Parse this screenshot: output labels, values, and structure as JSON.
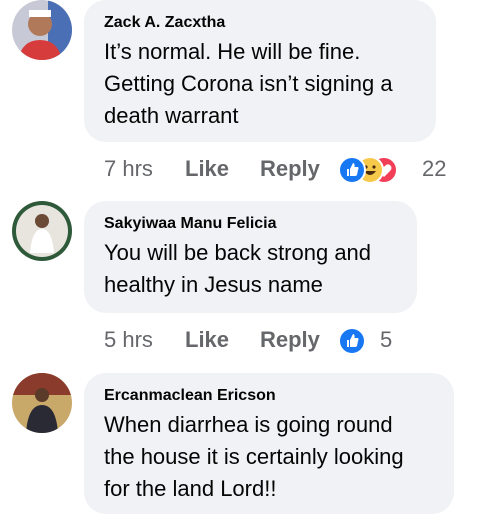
{
  "comments": [
    {
      "author": "Zack A. Zacxtha",
      "text": "It’s normal. He will be fine.\nGetting Corona isn’t signing a\ndeath warrant",
      "time": "7 hrs",
      "like_label": "Like",
      "reply_label": "Reply",
      "reactions": [
        "like-icon",
        "haha-icon",
        "love-icon"
      ],
      "reaction_count": "22"
    },
    {
      "author": "Sakyiwaa Manu Felicia",
      "text": "You will be back strong and\nhealthy in Jesus name",
      "time": "5 hrs",
      "like_label": "Like",
      "reply_label": "Reply",
      "reactions": [
        "like-icon"
      ],
      "reaction_count": "5"
    },
    {
      "author": "Ercanmaclean Ericson",
      "text": "When diarrhea is going round\nthe house it is certainly looking\nfor the land Lord!!",
      "time": "",
      "like_label": "",
      "reply_label": "",
      "reactions": [],
      "reaction_count": ""
    }
  ],
  "colors": {
    "bubble": "#f0f2f5",
    "meta": "#65676b",
    "like_blue": "#1877f2",
    "haha_yellow": "#f7c94b",
    "love_red": "#f33e58"
  }
}
